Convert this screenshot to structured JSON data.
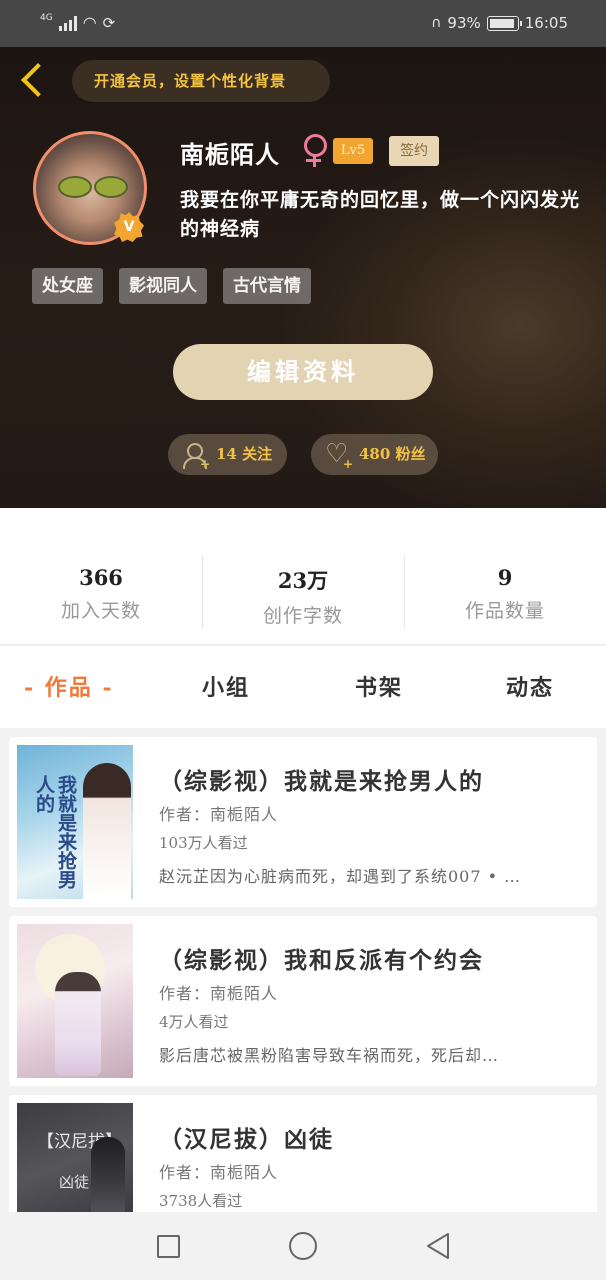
{
  "status_bar": {
    "network": "4G",
    "battery": "93%",
    "battery_level": 0.93,
    "time": "16:05"
  },
  "header": {
    "vip_prompt": "开通会员，设置个性化背景",
    "username": "南栀陌人",
    "level": "Lv5",
    "signed_badge": "签约",
    "verified_mark": "V",
    "bio": "我要在你平庸无奇的回忆里，做一个闪闪发光的神经病",
    "tags": [
      "处女座",
      "影视同人",
      "古代言情"
    ],
    "edit_button": "编辑资料",
    "following": "14 关注",
    "fans": "480 粉丝",
    "plus": "+"
  },
  "stats": [
    {
      "value": "366",
      "label": "加入天数"
    },
    {
      "value": "23万",
      "label": "创作字数"
    },
    {
      "value": "9",
      "label": "作品数量"
    }
  ],
  "tabs": [
    {
      "label": "- 作品 -",
      "active": true
    },
    {
      "label": "小组",
      "active": false
    },
    {
      "label": "书架",
      "active": false
    },
    {
      "label": "动态",
      "active": false
    }
  ],
  "books": [
    {
      "title": "（综影视）我就是来抢男人的",
      "author": "作者：南栀陌人",
      "views": "103万人看过",
      "summary": "赵沅芷因为心脏病而死，却遇到了系统007 • …",
      "cover_text": "我就是来抢男人的"
    },
    {
      "title": "（综影视）我和反派有个约会",
      "author": "作者：南栀陌人",
      "views": "4万人看过",
      "summary": "影后唐芯被黑粉陷害导致车祸而死，死后却…",
      "cover_text": ""
    },
    {
      "title": "（汉尼拔）凶徒",
      "author": "作者：南栀陌人",
      "views": "3738人看过",
      "summary": "",
      "cover_text": "【汉尼拔】",
      "cover_sub": "凶徒"
    }
  ],
  "colors": {
    "accent_gold": "#f2c246",
    "accent_orange": "#f07a3c",
    "level_badge": "#f2a531"
  }
}
